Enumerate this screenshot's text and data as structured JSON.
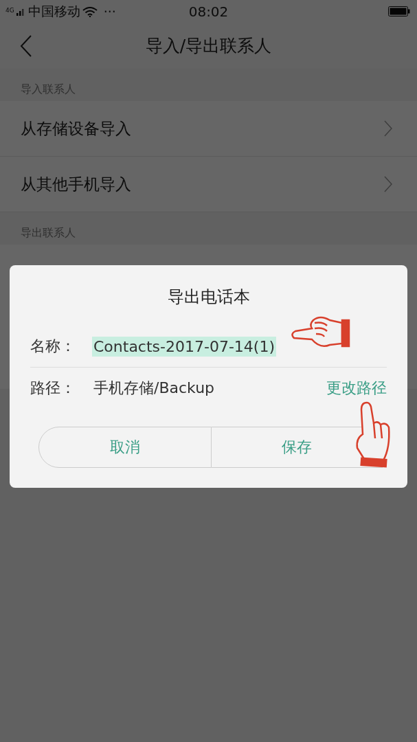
{
  "status_bar": {
    "network": "4G",
    "carrier": "中国移动",
    "more": "···",
    "time": "08:02"
  },
  "nav": {
    "title": "导入/导出联系人"
  },
  "sections": [
    {
      "header": "导入联系人",
      "rows": [
        {
          "label": "从存储设备导入"
        },
        {
          "label": "从其他手机导入"
        }
      ]
    },
    {
      "header": "导出联系人"
    }
  ],
  "dialog": {
    "title": "导出电话本",
    "fields": [
      {
        "label": "名称：",
        "value": "Contacts-2017-07-14(1)",
        "selected": true
      },
      {
        "label": "路径：",
        "value": "手机存储/Backup",
        "selected": false,
        "action": "更改路径"
      }
    ],
    "buttons": [
      {
        "label": "取消",
        "kind": "cancel"
      },
      {
        "label": "保存",
        "kind": "save"
      }
    ]
  }
}
